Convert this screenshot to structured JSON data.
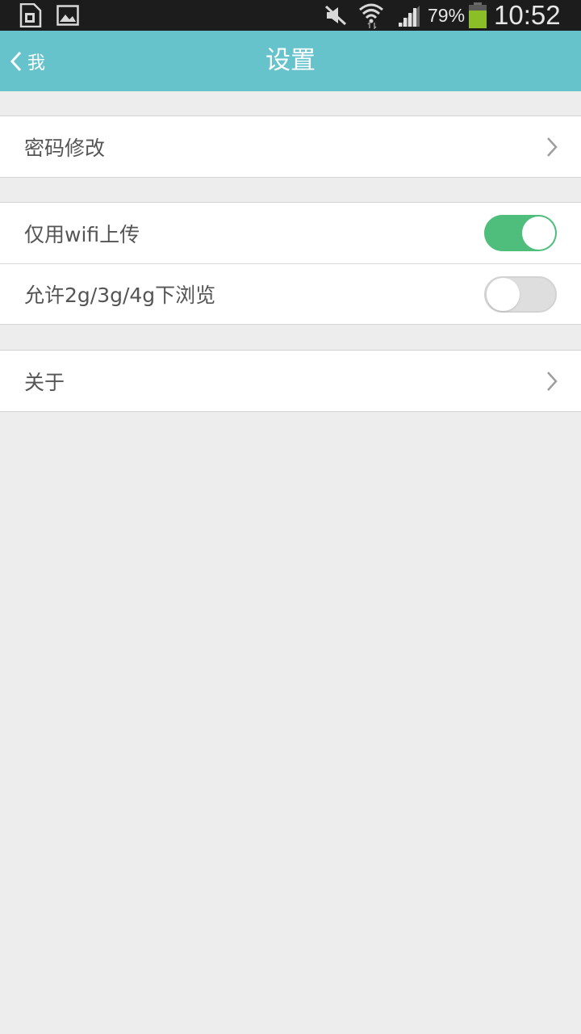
{
  "status_bar": {
    "battery_percent": "79%",
    "time": "10:52",
    "icons": [
      "sim-card-icon",
      "image-icon",
      "mute-icon",
      "wifi-icon",
      "signal-icon",
      "battery-icon"
    ],
    "battery_color": "#8cbf26"
  },
  "header": {
    "back_label": "我",
    "title": "设置",
    "background": "#66c3cc"
  },
  "settings": {
    "password_change": "密码修改",
    "wifi_upload": "仅用wifi上传",
    "wifi_upload_enabled": true,
    "mobile_browse": "允许2g/3g/4g下浏览",
    "mobile_browse_enabled": false,
    "about": "关于"
  },
  "colors": {
    "toggle_on": "#4fbe7d",
    "toggle_off": "#dedede",
    "page_bg": "#ededed"
  }
}
